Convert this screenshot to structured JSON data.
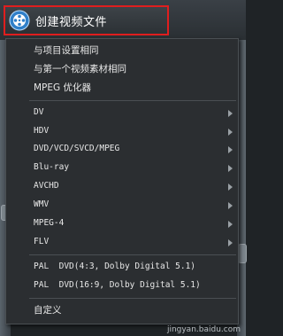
{
  "header": {
    "title": "创建视频文件",
    "icon": "disc-film-icon"
  },
  "menu": {
    "group1": [
      {
        "label": "与项目设置相同"
      },
      {
        "label": "与第一个视频素材相同"
      },
      {
        "label": "MPEG 优化器"
      }
    ],
    "group2": [
      {
        "label": "DV"
      },
      {
        "label": "HDV"
      },
      {
        "label": "DVD/VCD/SVCD/MPEG"
      },
      {
        "label": "Blu-ray"
      },
      {
        "label": "AVCHD"
      },
      {
        "label": "WMV"
      },
      {
        "label": "MPEG-4"
      },
      {
        "label": "FLV"
      }
    ],
    "group3": [
      {
        "label": "PAL  DVD(4:3, Dolby Digital 5.1)"
      },
      {
        "label": "PAL  DVD(16:9, Dolby Digital 5.1)"
      }
    ],
    "group4": [
      {
        "label": "自定义"
      }
    ]
  },
  "watermark": "jingyan.baidu.com"
}
